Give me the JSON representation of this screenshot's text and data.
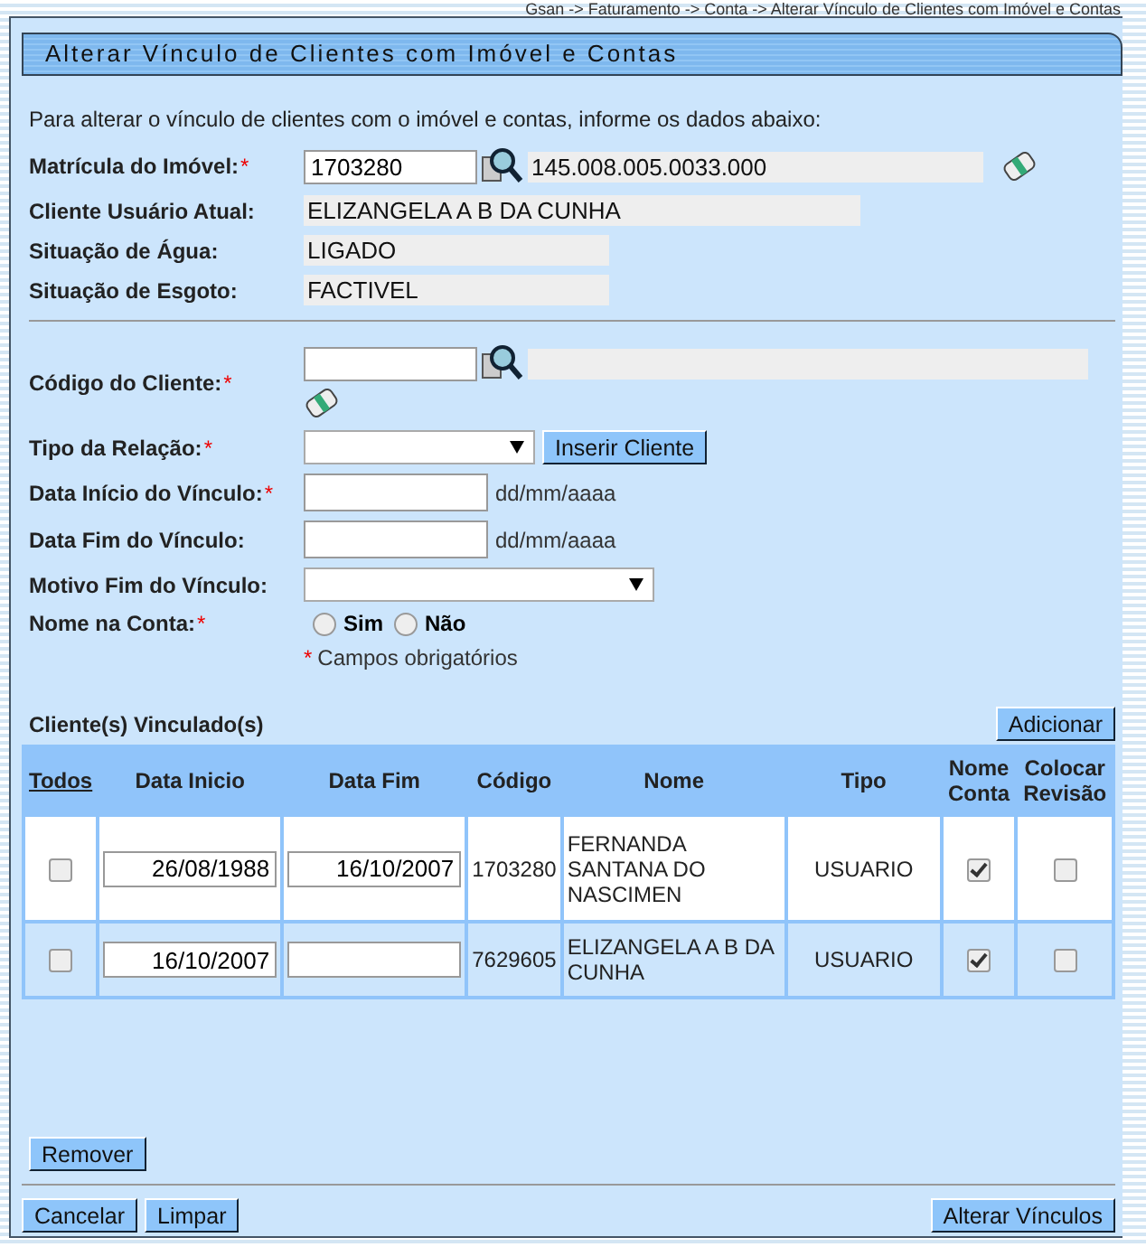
{
  "breadcrumb": "Gsan -> Faturamento -> Conta -> Alterar Vínculo de Clientes com Imóvel e Contas",
  "title": "Alterar Vínculo de Clientes com Imóvel e Contas",
  "intro": "Para alterar o vínculo de clientes com o imóvel e contas, informe os dados abaixo:",
  "required_mark": "*",
  "matricula": {
    "label": "Matrícula do Imóvel:",
    "required": true,
    "value": "1703280",
    "inscription": "145.008.005.0033.000"
  },
  "info_rows": [
    {
      "label": "Cliente Usuário Atual:",
      "value": "ELIZANGELA A B DA CUNHA",
      "wide": true
    },
    {
      "label": "Situação de Água:",
      "value": "LIGADO",
      "wide": false
    },
    {
      "label": "Situação de Esgoto:",
      "value": "FACTIVEL",
      "wide": false
    }
  ],
  "codigo_cliente": {
    "label": "Código do Cliente:",
    "required": true
  },
  "tipo_relacao": {
    "label": "Tipo da Relação:",
    "required": true,
    "button": "Inserir Cliente"
  },
  "date_fields": [
    {
      "label": "Data Início do Vínculo:",
      "required": true,
      "hint": "dd/mm/aaaa"
    },
    {
      "label": "Data Fim do Vínculo:",
      "required": false,
      "hint": "dd/mm/aaaa"
    }
  ],
  "motivo_fim": {
    "label": "Motivo Fim do Vínculo:",
    "required": false
  },
  "nome_na_conta": {
    "label": "Nome na Conta:",
    "required": true,
    "options": [
      {
        "label": "Sim",
        "selected": false
      },
      {
        "label": "Não",
        "selected": false
      }
    ]
  },
  "required_note": "Campos obrigatórios",
  "linked_clients": {
    "title": "Cliente(s) Vinculado(s)",
    "add_button": "Adicionar",
    "columns": [
      "Todos",
      "Data Inicio",
      "Data Fim",
      "Código",
      "Nome",
      "Tipo",
      "Nome Conta",
      "Colocar Revisão"
    ],
    "rows": [
      {
        "selected": false,
        "data_inicio": "26/08/1988",
        "data_fim": "16/10/2007",
        "codigo": "1703280",
        "nome": "FERNANDA SANTANA DO NASCIMEN",
        "tipo": "USUARIO",
        "nome_conta": true,
        "colocar_revisao": false
      },
      {
        "selected": false,
        "data_inicio": "16/10/2007",
        "data_fim": "",
        "codigo": "7629605",
        "nome": "ELIZANGELA A B DA CUNHA",
        "tipo": "USUARIO",
        "nome_conta": true,
        "colocar_revisao": false
      }
    ]
  },
  "remove_button": "Remover",
  "footer_buttons": {
    "left": [
      "Cancelar",
      "Limpar"
    ],
    "right": "Alterar Vínculos"
  }
}
